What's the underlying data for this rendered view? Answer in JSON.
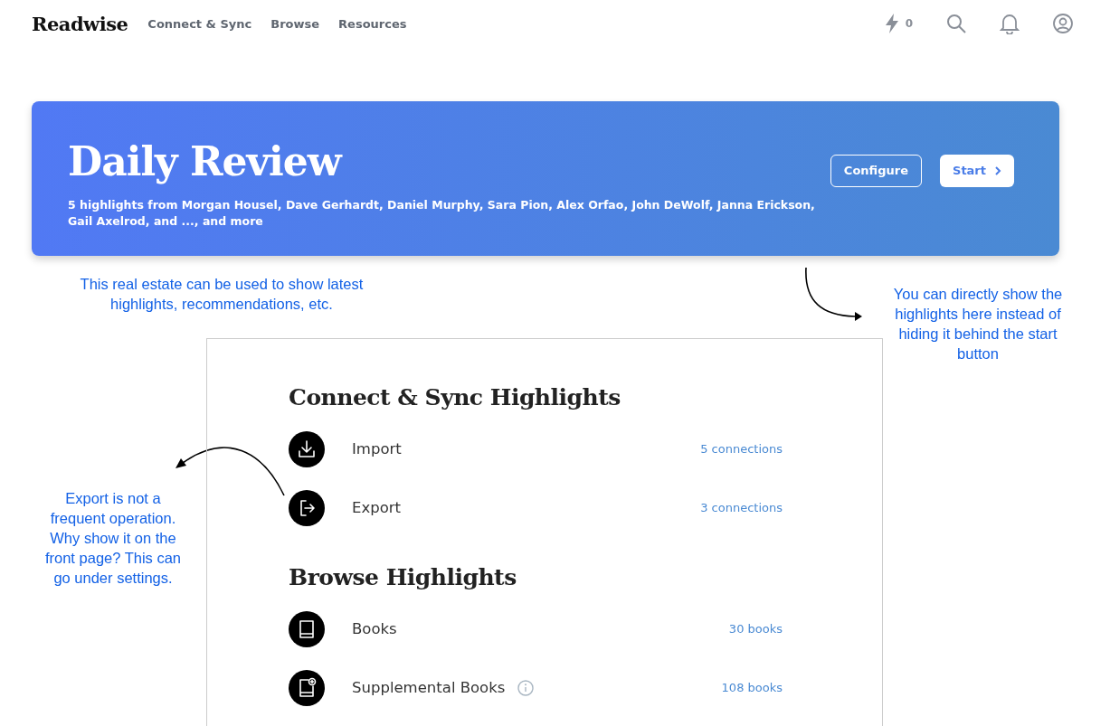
{
  "nav": {
    "logo": "Readwise",
    "links": [
      "Connect & Sync",
      "Browse",
      "Resources"
    ],
    "streak": "0"
  },
  "banner": {
    "title": "Daily Review",
    "subtitle": "5 highlights from Morgan Housel, Dave Gerhardt, Daniel Murphy, Sara Pion, Alex Orfao, John DeWolf, Janna Erickson, Gail Axelrod, and ..., and more",
    "buttons": [
      {
        "label": "Configure",
        "kind": "outline"
      },
      {
        "label": "Start",
        "kind": "solid"
      }
    ]
  },
  "annotations": [
    "This real estate can be used to show latest highlights, recommendations, etc.",
    "You can directly show the highlights here instead of hiding it behind the start button",
    "Export is not a frequent operation. Why show it on the front page? This can go under settings."
  ],
  "sections": [
    {
      "title": "Connect & Sync Highlights",
      "items": [
        {
          "kind": "import",
          "label": "Import",
          "count": "5 connections",
          "info": false
        },
        {
          "kind": "export",
          "label": "Export",
          "count": "3 connections",
          "info": false
        }
      ]
    },
    {
      "title": "Browse Highlights",
      "items": [
        {
          "kind": "book",
          "label": "Books",
          "count": "30 books",
          "info": false
        },
        {
          "kind": "supplemental",
          "label": "Supplemental Books",
          "count": "108 books",
          "info": true
        }
      ]
    }
  ]
}
